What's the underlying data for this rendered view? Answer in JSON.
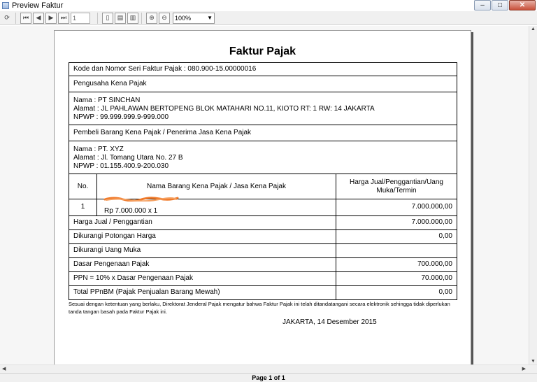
{
  "window": {
    "title": "Preview Faktur",
    "minimize": "–",
    "maximize": "□",
    "close": "✕"
  },
  "toolbar": {
    "page_field": "1",
    "zoom": "100%"
  },
  "document": {
    "title": "Faktur Pajak",
    "kode": "Kode dan Nomor Seri Faktur Pajak : 080.900-15.00000016",
    "pengusaha_header": "Pengusaha Kena Pajak",
    "seller": {
      "nama": "Nama : PT SINCHAN",
      "alamat": "Alamat : JL PAHLAWAN BERTOPENG BLOK MATAHARI NO.11, KIOTO RT: 1 RW: 14 JAKARTA",
      "npwp": "NPWP : 99.999.999.9-999.000"
    },
    "pembeli_header": "Pembeli Barang Kena Pajak / Penerima Jasa Kena Pajak",
    "buyer": {
      "nama": "Nama : PT. XYZ",
      "alamat": "Alamat : Jl. Tomang Utara No. 27 B",
      "npwp": "NPWP : 01.155.400.9-200.030"
    },
    "table": {
      "col_no": "No.",
      "col_nama": "Nama Barang Kena Pajak / Jasa Kena Pajak",
      "col_harga": "Harga Jual/Penggantian/Uang Muka/Termin",
      "item_no": "1",
      "item_desc": "Rp 7.000.000 x 1",
      "item_value": "7.000.000,00"
    },
    "summary": [
      {
        "label": "Harga Jual / Penggantian",
        "value": "7.000.000,00"
      },
      {
        "label": "Dikurangi Potongan Harga",
        "value": "0,00"
      },
      {
        "label": "Dikurangi Uang Muka",
        "value": ""
      },
      {
        "label": "Dasar Pengenaan Pajak",
        "value": "700.000,00"
      },
      {
        "label": "PPN = 10% x Dasar Pengenaan Pajak",
        "value": "70.000,00"
      },
      {
        "label": "Total PPnBM (Pajak Penjualan Barang Mewah)",
        "value": "0,00"
      }
    ],
    "footnote": "Sesuai dengan ketentuan yang berlaku, Direktorat Jenderal Pajak mengatur bahwa Faktur Pajak ini telah ditandatangani secara elektronik sehingga tidak diperlukan tanda tangan basah pada Faktur Pajak ini.",
    "place_date": "JAKARTA, 14 Desember 2015"
  },
  "status": {
    "page_indicator": "Page 1 of 1"
  }
}
